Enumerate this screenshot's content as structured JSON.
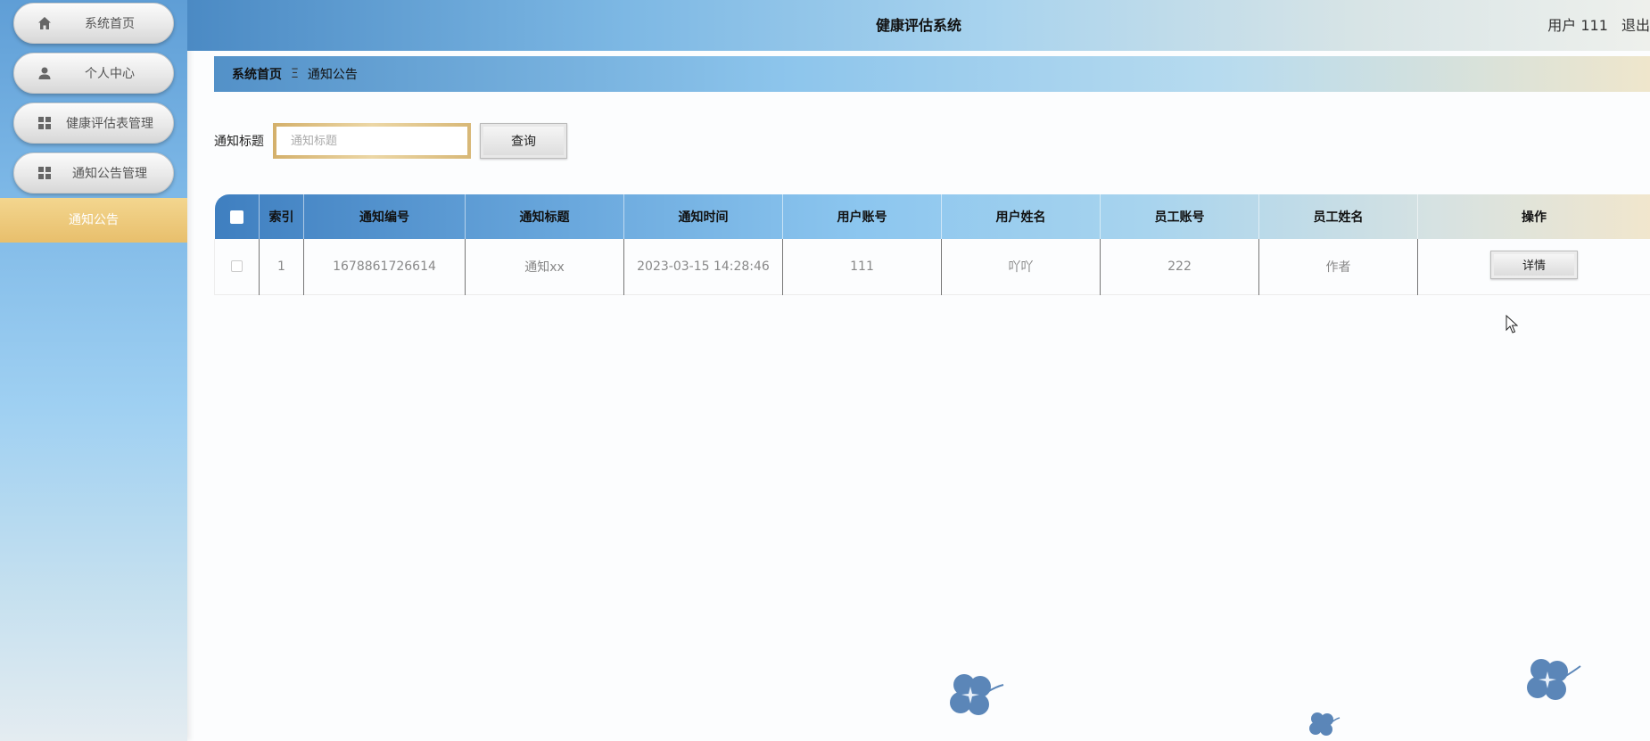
{
  "app": {
    "title": "健康评估系统",
    "user_label": "用户 111",
    "logout_label": "退出"
  },
  "sidebar": {
    "items": [
      {
        "label": "系统首页",
        "icon": "home-icon"
      },
      {
        "label": "个人中心",
        "icon": "user-icon"
      },
      {
        "label": "健康评估表管理",
        "icon": "grid-icon"
      },
      {
        "label": "通知公告管理",
        "icon": "grid-icon"
      }
    ],
    "active_subitem": "通知公告"
  },
  "breadcrumb": {
    "home": "系统首页",
    "separator": "Ξ",
    "current": "通知公告"
  },
  "search": {
    "label": "通知标题",
    "placeholder": "通知标题",
    "value": "",
    "button_label": "查询"
  },
  "table": {
    "columns": [
      "索引",
      "通知编号",
      "通知标题",
      "通知时间",
      "用户账号",
      "用户姓名",
      "员工账号",
      "员工姓名",
      "操作"
    ],
    "rows": [
      {
        "index": "1",
        "notice_no": "1678861726614",
        "title": "通知xx",
        "time": "2023-03-15 14:28:46",
        "user_account": "111",
        "user_name": "吖吖",
        "staff_account": "222",
        "staff_name": "作者",
        "action": "详情"
      }
    ]
  },
  "colors": {
    "sidebar_active": "#e8bf6c",
    "clover": "#5b86b8"
  }
}
